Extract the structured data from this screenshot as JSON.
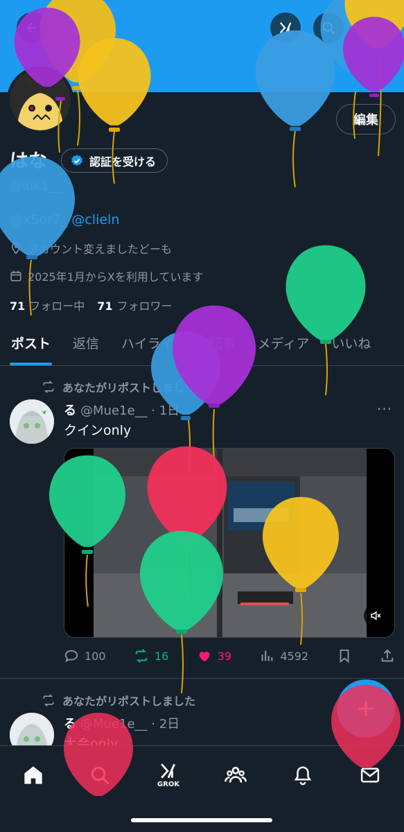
{
  "header": {
    "back_icon": "back-arrow-icon",
    "grok_icon": "grok-icon",
    "search_icon": "search-icon"
  },
  "profile": {
    "display_name": "はな",
    "verify_label": "認証を受ける",
    "handle": "@luk1__",
    "bio": "@xSor7_ @clieln",
    "location": "アカウント変えましたどーも",
    "joined": "2025年1月からXを利用しています",
    "following_count": "71",
    "following_label": "フォロー中",
    "followers_count": "71",
    "followers_label": "フォロワー",
    "edit_label": "編集"
  },
  "tabs": [
    "ポスト",
    "返信",
    "ハイライト",
    "記事",
    "メディア",
    "いいね"
  ],
  "posts": [
    {
      "repost_text": "あなたがリポストしました",
      "author_name": "る",
      "author_meta": "@Mue1e__ · 1日",
      "text": "クインonly",
      "replies": "100",
      "reposts": "16",
      "likes": "39",
      "views": "4592"
    },
    {
      "repost_text": "あなたがリポストしました",
      "author_name": "る",
      "author_meta": "@Mue1e__ · 2日",
      "text": "大会only"
    }
  ],
  "colors": {
    "accent": "#1d9bf0",
    "background": "#15202b",
    "repost": "#00ba7c",
    "like": "#f91880",
    "balloon_yellow": "#f5c518",
    "balloon_purple": "#9b30d9",
    "balloon_blue": "#2f9be0",
    "balloon_green": "#1ecf8a",
    "balloon_red": "#f0305a"
  },
  "nav": {
    "grok_label": "GROK"
  }
}
